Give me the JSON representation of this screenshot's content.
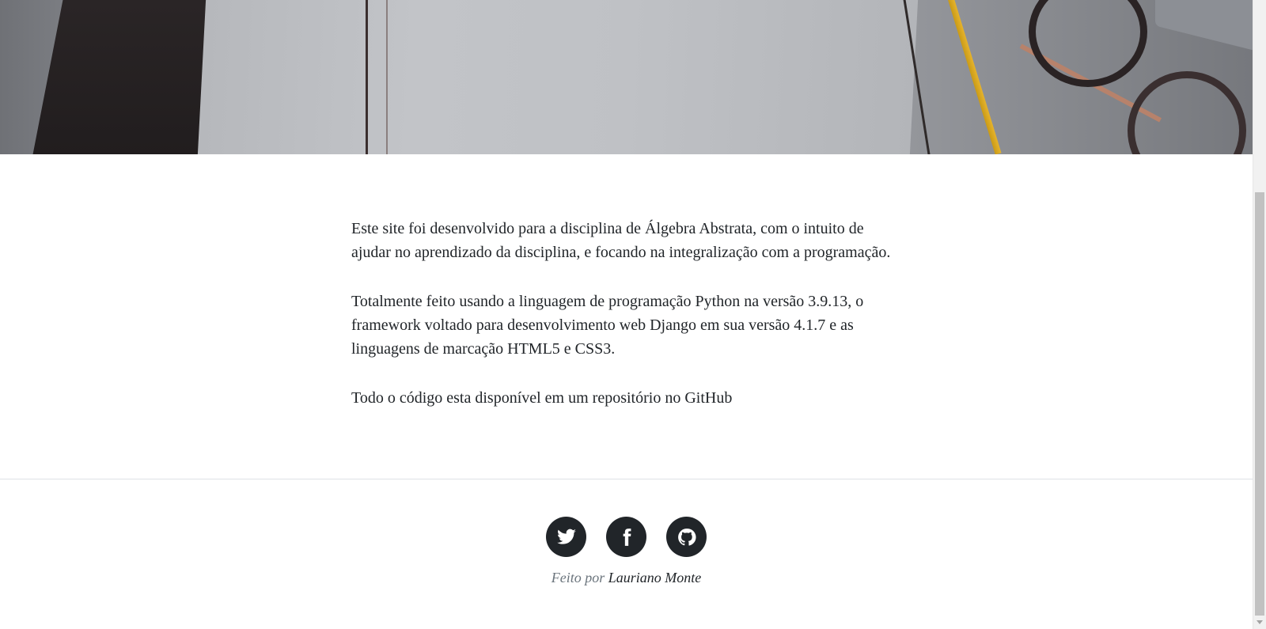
{
  "hero": {
    "image_name": "desk-workspace-photo"
  },
  "content": {
    "paragraphs": [
      "Este site foi desenvolvido para a disciplina de Álgebra Abstrata, com o intuito de ajudar no aprendizado da disciplina, e focando na integralização com a programação.",
      "Totalmente feito usando a linguagem de programação Python na versão 3.9.13, o framework voltado para desenvolvimento web Django em sua versão 4.1.7 e as linguagens de marcação HTML5 e CSS3.",
      "Todo o código esta disponível em um repositório no GitHub"
    ]
  },
  "footer": {
    "social_icons": [
      "twitter-icon",
      "facebook-icon",
      "github-icon"
    ],
    "credit_prefix": "Feito por",
    "credit_author": "Lauriano Monte"
  },
  "colors": {
    "text": "#212529",
    "muted": "#6c757d",
    "icon_bg": "#212529"
  }
}
